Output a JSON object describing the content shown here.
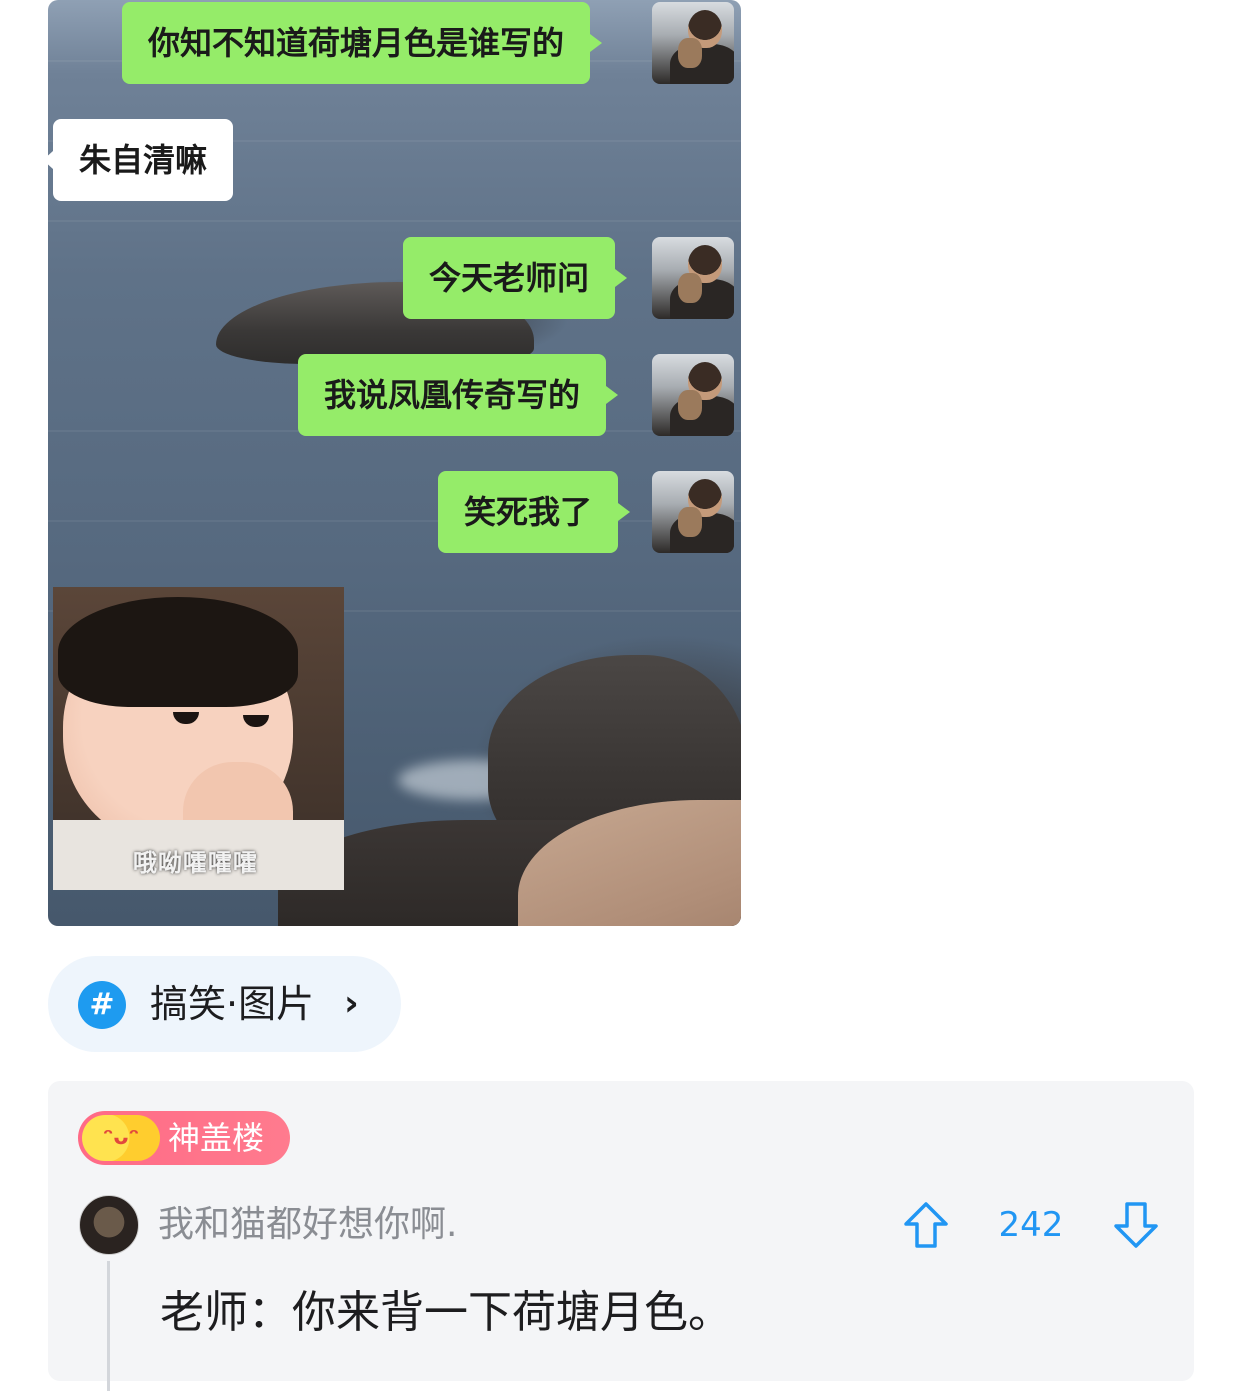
{
  "chat_image": {
    "messages": [
      {
        "text": "你知不知道荷塘月色是谁写的",
        "side": "right"
      },
      {
        "text": "朱自清嘛",
        "side": "left"
      },
      {
        "text": "今天老师问",
        "side": "right"
      },
      {
        "text": "我说凤凰传奇写的",
        "side": "right"
      },
      {
        "text": "笑死我了",
        "side": "right"
      }
    ],
    "sticker_caption": "哦呦嚯嚯嚯"
  },
  "tag": {
    "icon": "#",
    "label": "搞笑·图片",
    "chevron": "›"
  },
  "comment": {
    "badge_label": "神盖楼",
    "username": "我和猫都好想你啊.",
    "score": "242",
    "text": "老师：你来背一下荷塘月色。"
  },
  "colors": {
    "bubble_green": "#95ec69",
    "accent_blue": "#2196f3",
    "badge_pink": "#ff6a86"
  }
}
